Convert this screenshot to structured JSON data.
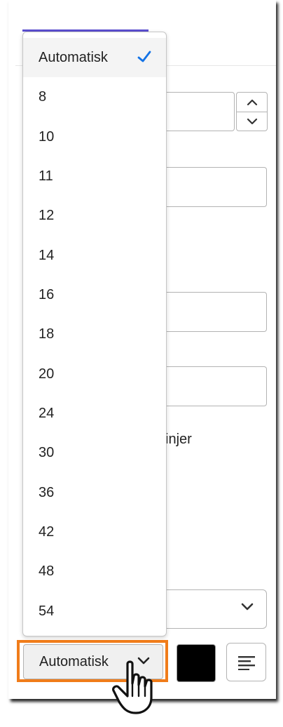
{
  "menu": {
    "items": [
      {
        "label": "Automatisk",
        "selected": true
      },
      {
        "label": "8"
      },
      {
        "label": "10"
      },
      {
        "label": "11"
      },
      {
        "label": "12"
      },
      {
        "label": "14"
      },
      {
        "label": "16"
      },
      {
        "label": "18"
      },
      {
        "label": "20"
      },
      {
        "label": "24"
      },
      {
        "label": "30"
      },
      {
        "label": "36"
      },
      {
        "label": "42"
      },
      {
        "label": "48"
      },
      {
        "label": "54"
      }
    ]
  },
  "background": {
    "partial_text": "injer"
  },
  "toolbar": {
    "font_size_value": "Automatisk",
    "text_color": "#000000",
    "accent": "#1473e6",
    "highlight_color": "#f07c1a"
  },
  "icons": [
    "checkmark-icon",
    "chevron-down-icon",
    "chevron-up-icon",
    "align-left-icon",
    "hand-cursor-icon"
  ]
}
